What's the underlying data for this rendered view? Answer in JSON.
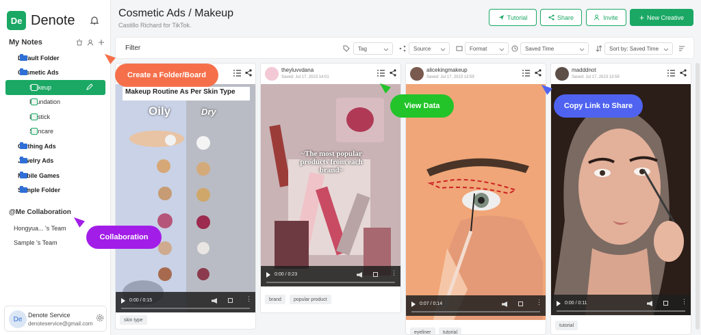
{
  "brand": {
    "logo_text": "De",
    "name": "Denote"
  },
  "sidebar": {
    "notes_title": "My Notes",
    "items": [
      {
        "label": "Default Folder",
        "type": "folder"
      },
      {
        "label": "Cosmetic Ads",
        "type": "folder"
      },
      {
        "label": "Makeup",
        "type": "board",
        "active": true
      },
      {
        "label": "Foundation",
        "type": "board"
      },
      {
        "label": "Lipstick",
        "type": "board"
      },
      {
        "label": "Skincare",
        "type": "board"
      },
      {
        "label": "Clothing Ads",
        "type": "folder"
      },
      {
        "label": "Jewelry Ads",
        "type": "folder"
      },
      {
        "label": "Mobile Games",
        "type": "folder"
      },
      {
        "label": "Sample Folder",
        "type": "folder"
      }
    ],
    "collab_title": "@Me Collaboration",
    "collab_items": [
      "Hongyua... 's Team",
      "Sample 's Team"
    ],
    "user": {
      "avatar": "De",
      "name": "Denote Service",
      "email": "denoteservice@gmail.com"
    }
  },
  "header": {
    "title": "Cosmetic Ads  / Makeup",
    "subtitle": "Castillo Richard for TikTok.",
    "buttons": {
      "tutorial": "Tutorial",
      "share": "Share",
      "invite": "Invite",
      "new_creative": "New Creative"
    }
  },
  "filter": {
    "label": "Filter",
    "tag": "Tag",
    "source": "Source",
    "format": "Format",
    "saved_time": "Saved Time",
    "sort": "Sort by: Saved Time"
  },
  "cards": [
    {
      "user": "",
      "saved": "",
      "image_title": "Makeup Routine As Per Skin Type",
      "left_label": "Oily",
      "right_label": "Dry",
      "time": "0:00 / 0:15",
      "tags": [
        "skin type"
      ]
    },
    {
      "user": "theyluvvdana",
      "saved": "Saved: Jul 17, 2023 14:01",
      "caption": "~The most popular products from each brand~",
      "time": "0:00 / 0:23",
      "tags": [
        "brand",
        "popular product"
      ]
    },
    {
      "user": "alicekingmakeup",
      "saved": "Saved: Jul 17, 2023 13:59",
      "time": "0:07 / 0:14",
      "tags": [
        "eyeliner",
        "tutorial"
      ]
    },
    {
      "user": "madddnot",
      "saved": "Saved: Jul 17, 2023 13:59",
      "time": "0:00 / 0:11",
      "tags": [
        "tutorial"
      ]
    }
  ],
  "callouts": {
    "create": "Create a Folder/Board",
    "view": "View Data",
    "copy": "Copy Link to Share",
    "collab": "Collaboration"
  },
  "colors": {
    "brand_green": "#1aa864",
    "callout_orange": "#f5704a",
    "callout_green": "#22c42a",
    "callout_blue": "#4f63f0",
    "callout_purple": "#a21ee8"
  }
}
